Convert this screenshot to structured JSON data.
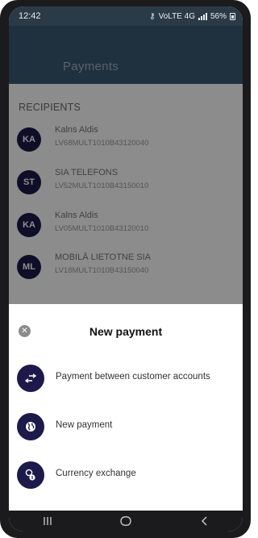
{
  "status_bar": {
    "time": "12:42",
    "network": "VoLTE 4G",
    "battery": "56%"
  },
  "header": {
    "title": "Payments"
  },
  "recipients": {
    "title": "RECIPIENTS",
    "items": [
      {
        "initials": "KA",
        "name": "Kalns Aldis",
        "iban": "LV68MULT1010B43120040"
      },
      {
        "initials": "ST",
        "name": "SIA TELEFONS",
        "iban": "LV52MULT1010B43150010"
      },
      {
        "initials": "KA",
        "name": "Kalns Aldis",
        "iban": "LV05MULT1010B43120010"
      },
      {
        "initials": "ML",
        "name": "MOBILĀ LIETOTNE SIA",
        "iban": "LV18MULT1010B43150040"
      }
    ]
  },
  "sheet": {
    "title": "New payment",
    "options": [
      {
        "label": "Payment between customer accounts",
        "icon": "transfer-arrows-icon"
      },
      {
        "label": "New payment",
        "icon": "globe-icon"
      },
      {
        "label": "Currency exchange",
        "icon": "currency-exchange-icon"
      }
    ]
  },
  "colors": {
    "header": "#3a5a73",
    "accent_dark": "#1c1a4a",
    "scrim": "rgba(0,0,0,0.45)"
  }
}
